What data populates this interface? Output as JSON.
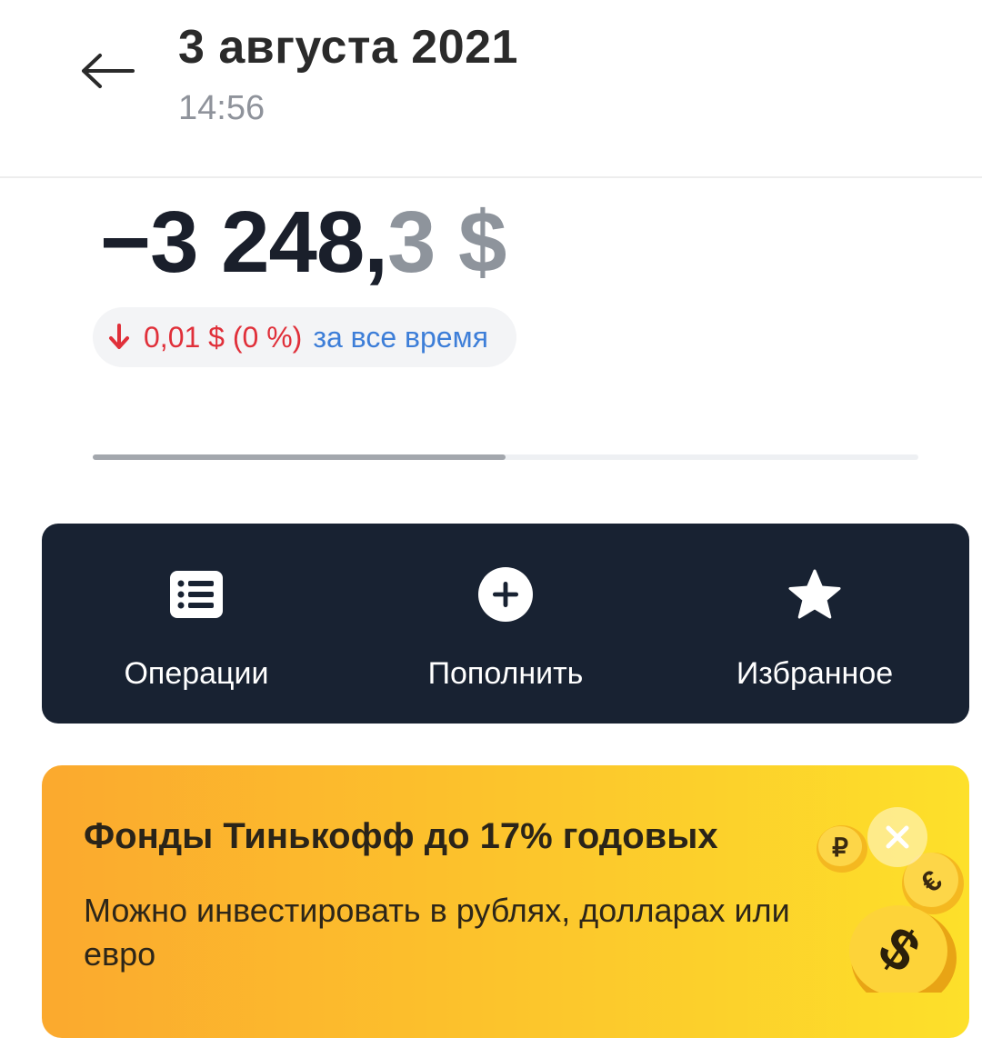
{
  "header": {
    "title": "3 августа 2021",
    "time": "14:56"
  },
  "balance": {
    "integer_part": "−3 248,",
    "fraction_part": "3 $"
  },
  "change": {
    "value": "0,01 $ (0 %)",
    "period": "за все время",
    "direction": "down",
    "color": "#e0303a"
  },
  "progress": {
    "fraction": 0.5
  },
  "actions": [
    {
      "label": "Операции",
      "icon": "list-icon"
    },
    {
      "label": "Пополнить",
      "icon": "plus-circle-icon"
    },
    {
      "label": "Избранное",
      "icon": "star-icon"
    }
  ],
  "promo": {
    "title": "Фонды Тинькофф до 17% годовых",
    "text": "Можно инвестировать в рублях, долларах или евро",
    "coin_symbols": [
      "₽",
      "€",
      "$"
    ]
  },
  "colors": {
    "action_bar": "#182232",
    "promo_gradient_start": "#fba92e",
    "promo_gradient_end": "#fde02a",
    "link": "#3d7ed8"
  }
}
